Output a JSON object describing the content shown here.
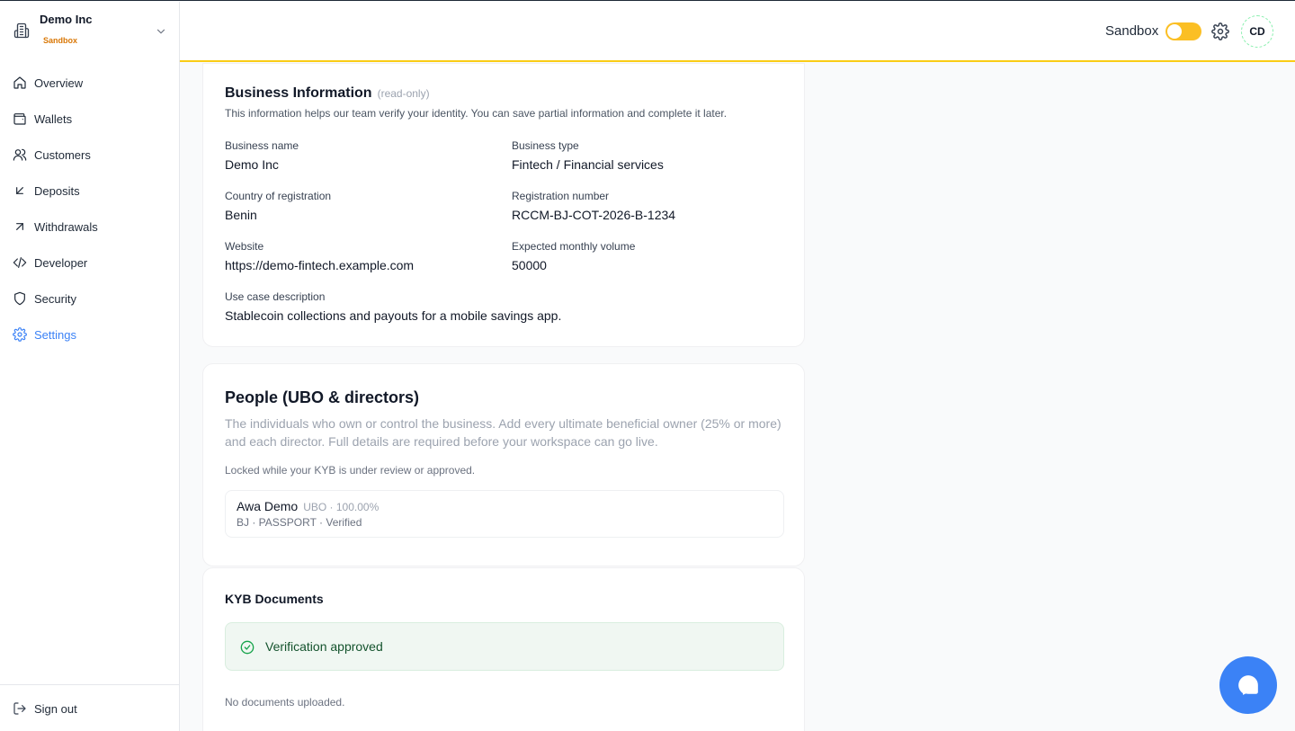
{
  "org": {
    "name": "Demo Inc",
    "badge": "Sandbox"
  },
  "nav": {
    "items": [
      {
        "label": "Overview",
        "icon": "home-icon"
      },
      {
        "label": "Wallets",
        "icon": "wallet-icon"
      },
      {
        "label": "Customers",
        "icon": "users-icon"
      },
      {
        "label": "Deposits",
        "icon": "arrow-down-left-icon"
      },
      {
        "label": "Withdrawals",
        "icon": "arrow-up-right-icon"
      },
      {
        "label": "Developer",
        "icon": "code-icon"
      },
      {
        "label": "Security",
        "icon": "shield-icon"
      },
      {
        "label": "Settings",
        "icon": "gear-icon",
        "active": true
      }
    ],
    "sign_out": "Sign out"
  },
  "header": {
    "sandbox_label": "Sandbox",
    "sandbox_on": true,
    "avatar_initials": "CD",
    "accent": "#facc15"
  },
  "business": {
    "title": "Business Information",
    "readonly": "(read-only)",
    "description": "This information helps our team verify your identity. You can save partial information and complete it later.",
    "fields": {
      "name": {
        "label": "Business name",
        "value": "Demo Inc"
      },
      "type": {
        "label": "Business type",
        "value": "Fintech / Financial services"
      },
      "country": {
        "label": "Country of registration",
        "value": "Benin"
      },
      "reg_number": {
        "label": "Registration number",
        "value": "RCCM-BJ-COT-2026-B-1234"
      },
      "website": {
        "label": "Website",
        "value": "https://demo-fintech.example.com"
      },
      "volume": {
        "label": "Expected monthly volume",
        "value": "50000"
      },
      "use_case": {
        "label": "Use case description",
        "value": "Stablecoin collections and payouts for a mobile savings app."
      }
    }
  },
  "people": {
    "title": "People (UBO & directors)",
    "description": "The individuals who own or control the business. Add every ultimate beneficial owner (25% or more) and each director. Full details are required before your workspace can go live.",
    "locked_note": "Locked while your KYB is under review or approved.",
    "list": [
      {
        "name": "Awa Demo",
        "role": "UBO · 100.00%",
        "meta": "BJ · PASSPORT · Verified"
      }
    ]
  },
  "kyb": {
    "title": "KYB Documents",
    "status": "Verification approved",
    "empty": "No documents uploaded."
  },
  "colors": {
    "primary": "#3b82f6",
    "success": "#16a34a",
    "sandbox": "#fbbf24"
  }
}
